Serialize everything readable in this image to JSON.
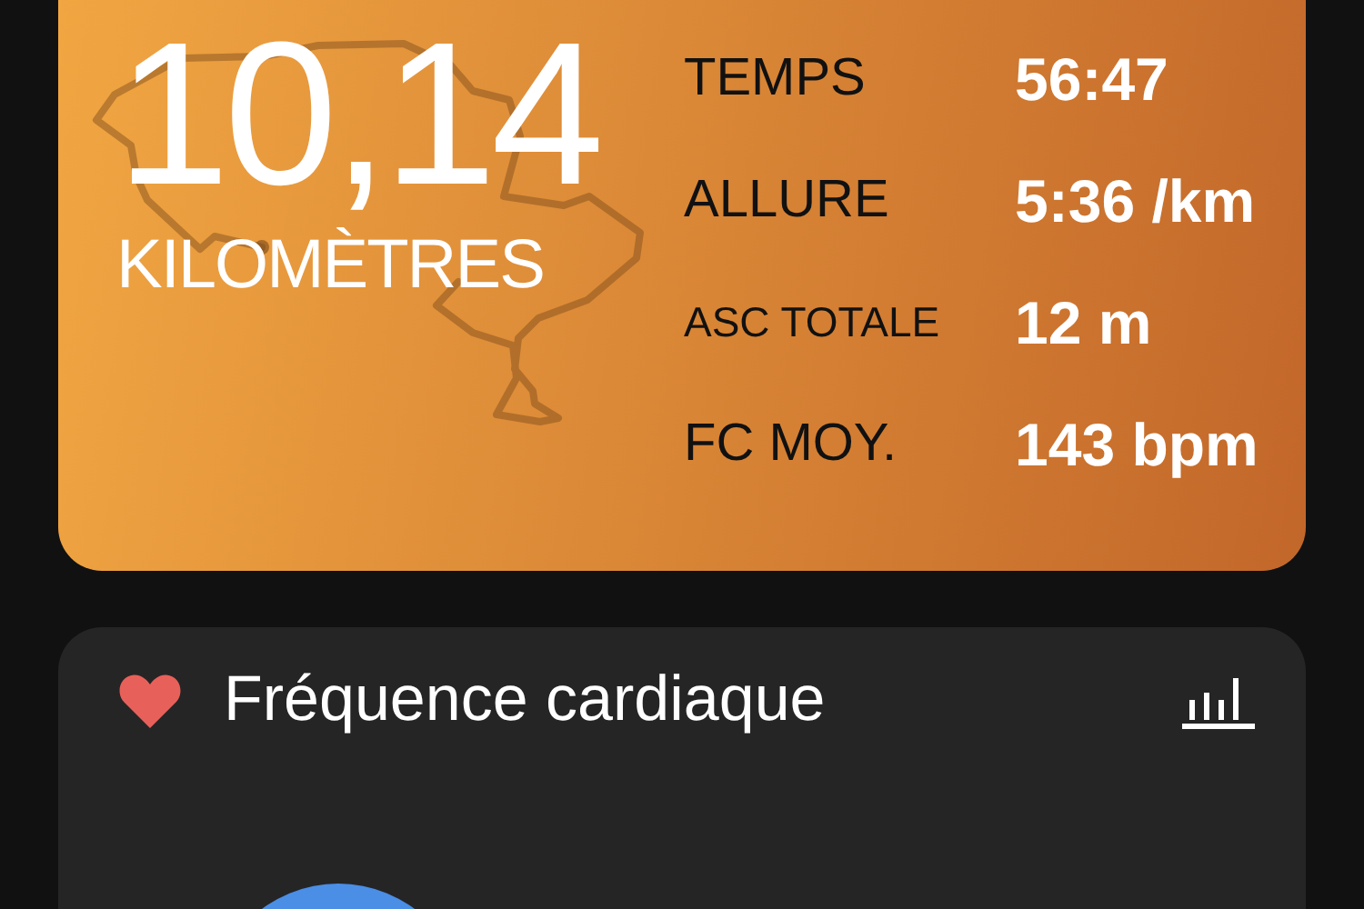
{
  "summary": {
    "distance": "10,14",
    "unit": "KILOMÈTRES",
    "stats": [
      {
        "label": "TEMPS",
        "value": "56:47",
        "kind": "normal"
      },
      {
        "label": "ALLURE",
        "value": "5:36 /km",
        "kind": "normal"
      },
      {
        "label": "ASC TOTALE",
        "value": "12 m",
        "kind": "compact"
      },
      {
        "label": "FC MOY.",
        "value": "143 bpm",
        "kind": "normal"
      }
    ]
  },
  "heart_rate": {
    "title": "Fréquence cardiaque"
  }
}
